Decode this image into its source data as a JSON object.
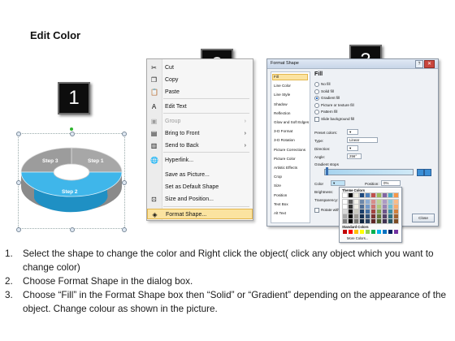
{
  "title": "Edit Color",
  "badges": [
    "1",
    "2",
    "3"
  ],
  "donut": {
    "labels": [
      "Step 1",
      "Step 2",
      "Step 3"
    ],
    "colors": {
      "top": "#a9a9a9",
      "selected": "#3fb6ea",
      "side": "#878787",
      "selected_side": "#1f8fc2"
    }
  },
  "context_menu": {
    "items": [
      {
        "label": "Cut",
        "icon": "scissors-icon",
        "glyph": "✂",
        "enabled": true
      },
      {
        "label": "Copy",
        "icon": "copy-icon",
        "glyph": "❐",
        "enabled": true
      },
      {
        "label": "Paste",
        "icon": "paste-icon",
        "glyph": "📋",
        "enabled": true
      },
      {
        "label": "Edit Text",
        "icon": "edit-text-icon",
        "glyph": "A",
        "enabled": true
      },
      {
        "label": "Group",
        "icon": "group-icon",
        "glyph": "▣",
        "enabled": false,
        "submenu": true
      },
      {
        "label": "Bring to Front",
        "icon": "bring-front-icon",
        "glyph": "▤",
        "enabled": true,
        "submenu": true
      },
      {
        "label": "Send to Back",
        "icon": "send-back-icon",
        "glyph": "▥",
        "enabled": true,
        "submenu": true
      },
      {
        "label": "Hyperlink...",
        "icon": "hyperlink-icon",
        "glyph": "🌐",
        "enabled": true
      },
      {
        "label": "Save as Picture...",
        "icon": "",
        "glyph": "",
        "enabled": true
      },
      {
        "label": "Set as Default Shape",
        "icon": "",
        "glyph": "",
        "enabled": true
      },
      {
        "label": "Size and Position...",
        "icon": "size-position-icon",
        "glyph": "⊡",
        "enabled": true
      },
      {
        "label": "Format Shape...",
        "icon": "format-shape-icon",
        "glyph": "◈",
        "enabled": true,
        "highlighted": true
      }
    ]
  },
  "dialog": {
    "title": "Format Shape",
    "help": "?",
    "close_x": "✕",
    "nav": [
      "Fill",
      "Line Color",
      "Line Style",
      "Shadow",
      "Reflection",
      "Glow and Soft Edges",
      "3-D Format",
      "3-D Rotation",
      "Picture Corrections",
      "Picture Color",
      "Artistic Effects",
      "Crop",
      "Size",
      "Position",
      "Text Box",
      "Alt Text"
    ],
    "fill_heading": "Fill",
    "fill_options": [
      {
        "label": "No fill",
        "type": "radio",
        "checked": false
      },
      {
        "label": "Solid fill",
        "type": "radio",
        "checked": false
      },
      {
        "label": "Gradient fill",
        "type": "radio",
        "checked": true
      },
      {
        "label": "Picture or texture fill",
        "type": "radio",
        "checked": false
      },
      {
        "label": "Pattern fill",
        "type": "radio",
        "checked": false
      },
      {
        "label": "Slide background fill",
        "type": "checkbox",
        "checked": false
      }
    ],
    "preset_label": "Preset colors:",
    "type_label": "Type:",
    "type_value": "Linear",
    "direction_label": "Direction:",
    "angle_label": "Angle:",
    "angle_value": "256°",
    "stops_label": "Gradient stops",
    "color_label": "Color",
    "position_label": "Position:",
    "position_value": "0%",
    "brightness_label": "Brightness:",
    "transparency_label": "Transparency:",
    "rotate_label": "Rotate with shape",
    "close_label": "Close",
    "palette": {
      "theme_label": "Theme Colors",
      "standard_label": "Standard Colors",
      "more_label": "More Colors...",
      "theme_cols": [
        "#ffffff",
        "#000000",
        "#eeece1",
        "#1f497d",
        "#4f81bd",
        "#c0504d",
        "#9bbb59",
        "#8064a2",
        "#4bacc6",
        "#f79646"
      ],
      "standard": [
        "#c00000",
        "#ff0000",
        "#ffc000",
        "#ffff00",
        "#92d050",
        "#00b050",
        "#00b0f0",
        "#0070c0",
        "#002060",
        "#7030a0"
      ]
    }
  },
  "steps": [
    {
      "num": "1.",
      "text": "Select the shape to change the color and Right click the object( click any object which you want to change color)"
    },
    {
      "num": "2.",
      "text": "Choose Format Shape in the dialog box."
    },
    {
      "num": "3.",
      "text": "Choose “Fill” in the Format Shape box then “Solid” or “Gradient” depending on the appearance of the object. Change colour as shown in the picture."
    }
  ]
}
